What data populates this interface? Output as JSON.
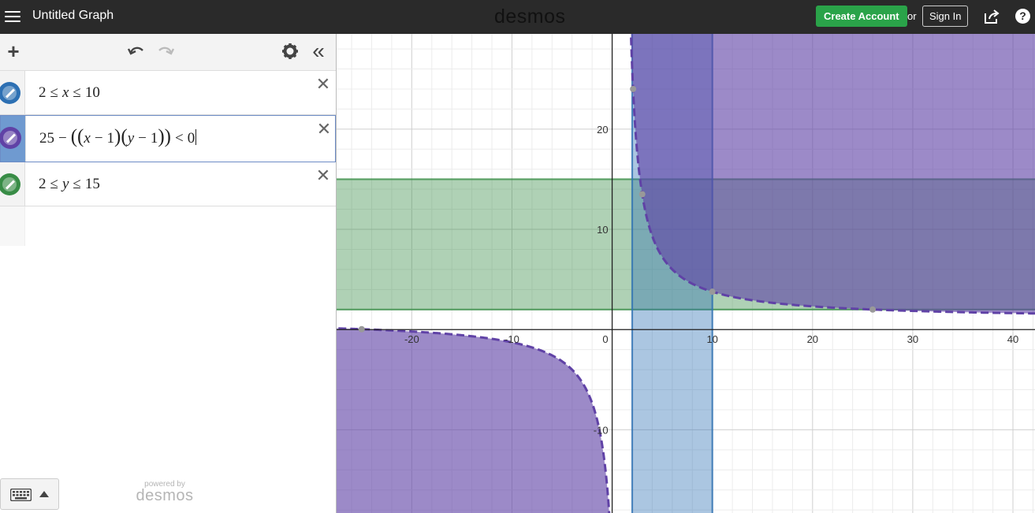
{
  "header": {
    "menu_icon": "hamburger-menu-icon",
    "title": "Untitled Graph",
    "brand": "desmos",
    "create_account": "Create Account",
    "or": "or",
    "sign_in": "Sign In",
    "share_icon": "share-icon",
    "help": "?"
  },
  "toolbar": {
    "add": "+",
    "undo_icon": "undo-icon",
    "redo_icon": "redo-icon",
    "settings_icon": "gear-icon",
    "collapse": "«"
  },
  "expressions": [
    {
      "latex_parts": [
        "2",
        "≤",
        "x",
        "≤",
        "10"
      ],
      "color": "#2d70b3",
      "active": false
    },
    {
      "latex_parts": [
        "25",
        "−",
        "(",
        "(",
        "x",
        "−",
        "1",
        ")",
        "(",
        "y",
        "−",
        "1",
        ")",
        ")",
        "<",
        "0"
      ],
      "color": "#6042a6",
      "active": true
    },
    {
      "latex_parts": [
        "2",
        "≤",
        "y",
        "≤",
        "15"
      ],
      "color": "#388c46",
      "active": false
    }
  ],
  "keypad": {
    "keyboard_icon": "keyboard-icon"
  },
  "powered_by": {
    "line1": "powered by",
    "line2": "desmos"
  },
  "graph": {
    "x_ticks": [
      "-20",
      "-10",
      "0",
      "10",
      "20",
      "30",
      "40"
    ],
    "y_ticks": [
      "20",
      "10",
      "-10"
    ],
    "x_tick_values": [
      -20,
      -10,
      10,
      20,
      30,
      40
    ],
    "y_tick_values": [
      20,
      10,
      -10
    ],
    "origin_label": "0",
    "view": {
      "xmin": -27.5,
      "xmax": 42.2,
      "ymin": -18.3,
      "ymax": 29.5
    },
    "colors": {
      "blue": "#2d70b3",
      "purple": "#6042a6",
      "green": "#388c46"
    }
  }
}
